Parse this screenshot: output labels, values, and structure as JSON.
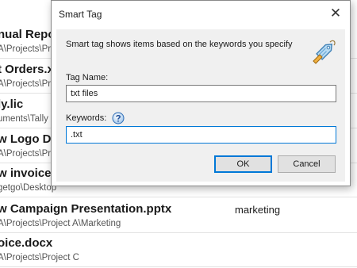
{
  "files": [
    {
      "name": "nual Repo",
      "path": "A\\Projects\\Proj",
      "tag": ""
    },
    {
      "name": "t Orders.x",
      "path": "A\\Projects\\Proj",
      "tag": ""
    },
    {
      "name": "ly.lic",
      "path": "uments\\Tally",
      "tag": ""
    },
    {
      "name": "w Logo D",
      "path": "A\\Projects\\Proj",
      "tag": ""
    },
    {
      "name": "w invoice",
      "path": "getgo\\Desktop",
      "tag": ""
    },
    {
      "name": "w Campaign Presentation.pptx",
      "path": "A\\Projects\\Project A\\Marketing",
      "tag": "marketing"
    },
    {
      "name": "oice.docx",
      "path": "A\\Projects\\Project C",
      "tag": ""
    }
  ],
  "dialog": {
    "title": "Smart Tag",
    "close_glyph": "✕",
    "description": "Smart tag shows items based on the keywords you specify",
    "tag_name_label": "Tag Name:",
    "tag_name_value": "txt files",
    "keywords_label": "Keywords:",
    "keywords_value": ".txt",
    "ok_label": "OK",
    "cancel_label": "Cancel",
    "icons": {
      "tag": "tag-icon",
      "help": "help-icon",
      "close": "close-icon"
    },
    "accent_color": "#0078d7"
  }
}
